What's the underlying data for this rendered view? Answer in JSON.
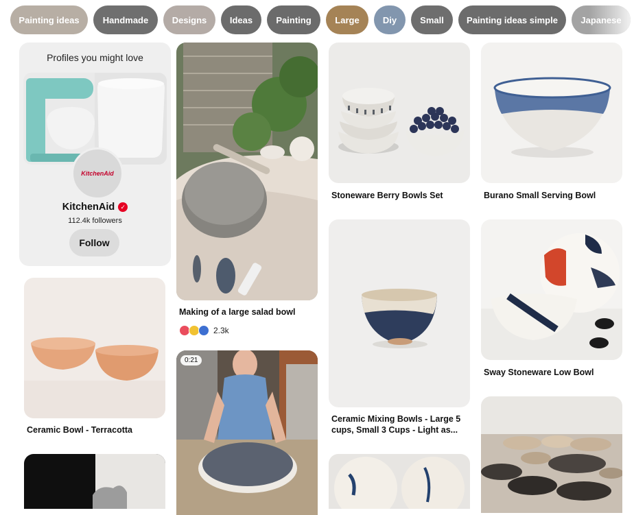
{
  "chips": [
    {
      "label": "Painting ideas",
      "color": "#b7aea4"
    },
    {
      "label": "Handmade",
      "color": "#6f6f6f"
    },
    {
      "label": "Designs",
      "color": "#b4aba6"
    },
    {
      "label": "Ideas",
      "color": "#6c6c6c"
    },
    {
      "label": "Painting",
      "color": "#6b6b6b"
    },
    {
      "label": "Large",
      "color": "#a58356"
    },
    {
      "label": "Diy",
      "color": "#8296ae"
    },
    {
      "label": "Small",
      "color": "#6e6e6e"
    },
    {
      "label": "Painting ideas simple",
      "color": "#6c6c6c"
    },
    {
      "label": "Japanese",
      "color": "#a3a3a3"
    }
  ],
  "profile": {
    "heading": "Profiles you might love",
    "name": "KitchenAid",
    "followers": "112.4k followers",
    "follow_label": "Follow",
    "avatar_text": "KitchenAid"
  },
  "pins": {
    "salad_bowl": {
      "title": "Making of a large salad bowl",
      "reactions": "2.3k"
    },
    "video": {
      "duration": "0:21"
    },
    "berry_bowls": {
      "title": "Stoneware Berry Bowls Set"
    },
    "burano": {
      "title": "Burano Small Serving Bowl"
    },
    "mixing_bowls": {
      "title_line1": "Ceramic Mixing Bowls - Large 5",
      "title_line2": "cups, Small 3 Cups - Light as..."
    },
    "sway": {
      "title": "Sway Stoneware Low Bowl"
    },
    "terracotta": {
      "title": "Ceramic Bowl - Terracotta"
    }
  },
  "colors": {
    "verified": "#e60023",
    "card_bg": "#efefef"
  }
}
